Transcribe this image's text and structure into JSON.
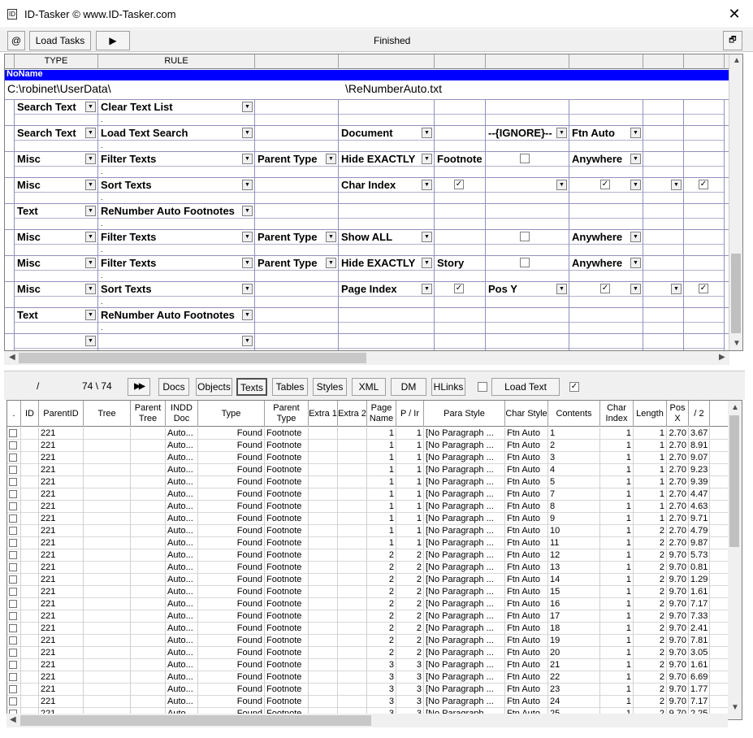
{
  "window": {
    "title": "ID-Tasker  © www.ID-Tasker.com",
    "close_glyph": "✕"
  },
  "toolbar": {
    "at_label": "@",
    "load_tasks": "Load Tasks",
    "play_glyph": "▶",
    "status": "Finished",
    "restore_glyph": "🗗"
  },
  "rules": {
    "header": {
      "type": "TYPE",
      "rule": "RULE"
    },
    "title_row": "NoName",
    "path_left": "C:\\robinet\\UserData\\",
    "path_right": "\\ReNumberAuto.txt",
    "rows": [
      {
        "type": "Search Text",
        "rule": "Clear Text List",
        "c3": "",
        "c4": "",
        "c5": "",
        "c6": "",
        "c7": ""
      },
      {
        "type": "Search Text",
        "rule": "Load Text Search",
        "c3": "",
        "c4": "Document",
        "c5": "",
        "c6": "--{IGNORE}--",
        "c7": "Ftn Auto"
      },
      {
        "type": "Misc",
        "rule": "Filter Texts",
        "c3": "Parent Type",
        "c4": "Hide EXACTLY",
        "c5": "Footnote",
        "c6": "",
        "c7": "Anywhere"
      },
      {
        "type": "Misc",
        "rule": "Sort Texts",
        "c3": "",
        "c4": "Char Index",
        "c5": "",
        "c6": "",
        "c7": ""
      },
      {
        "type": "Text",
        "rule": "ReNumber Auto Footnotes",
        "c3": "",
        "c4": "",
        "c5": "",
        "c6": "",
        "c7": ""
      },
      {
        "type": "Misc",
        "rule": "Filter Texts",
        "c3": "Parent Type",
        "c4": "Show ALL",
        "c5": "",
        "c6": "",
        "c7": "Anywhere"
      },
      {
        "type": "Misc",
        "rule": "Filter Texts",
        "c3": "Parent Type",
        "c4": "Hide EXACTLY",
        "c5": "Story",
        "c6": "",
        "c7": "Anywhere"
      },
      {
        "type": "Misc",
        "rule": "Sort Texts",
        "c3": "",
        "c4": "Page Index",
        "c5": "",
        "c6": "Pos Y",
        "c7": ""
      },
      {
        "type": "Text",
        "rule": "ReNumber Auto Footnotes",
        "c3": "",
        "c4": "",
        "c5": "",
        "c6": "",
        "c7": ""
      },
      {
        "type": "",
        "rule": "",
        "c3": "",
        "c4": "",
        "c5": "",
        "c6": "",
        "c7": ""
      }
    ]
  },
  "lower_toolbar": {
    "slash": "/",
    "count": "74 \\ 74",
    "ff_glyph": "▶▶",
    "docs": "Docs",
    "objects": "Objects",
    "texts": "Texts",
    "tables": "Tables",
    "styles": "Styles",
    "xml": "XML",
    "dm": "DM",
    "hlinks": "HLinks",
    "load_text": "Load Text",
    "check_mark": "✓"
  },
  "grid": {
    "headers": [
      ".",
      "ID",
      "ParentID",
      "Tree",
      "Parent Tree",
      "INDD Doc",
      "Type",
      "Parent Type",
      "Extra 1",
      "Extra 2",
      "Page Name",
      "P / Ir",
      "Para Style",
      "Char Style",
      "Contents",
      "Char Index",
      "Length",
      "Pos X",
      "/ 2"
    ],
    "rows": [
      [
        "221",
        "Auto...",
        "Found",
        "Footnote",
        "1",
        "1",
        "[No Paragraph ...",
        "Ftn Auto",
        "1",
        "1",
        "1",
        "2.70",
        "3.67"
      ],
      [
        "221",
        "Auto...",
        "Found",
        "Footnote",
        "1",
        "1",
        "[No Paragraph ...",
        "Ftn Auto",
        "2",
        "1",
        "1",
        "2.70",
        "8.91"
      ],
      [
        "221",
        "Auto...",
        "Found",
        "Footnote",
        "1",
        "1",
        "[No Paragraph ...",
        "Ftn Auto",
        "3",
        "1",
        "1",
        "2.70",
        "9.07"
      ],
      [
        "221",
        "Auto...",
        "Found",
        "Footnote",
        "1",
        "1",
        "[No Paragraph ...",
        "Ftn Auto",
        "4",
        "1",
        "1",
        "2.70",
        "9.23"
      ],
      [
        "221",
        "Auto...",
        "Found",
        "Footnote",
        "1",
        "1",
        "[No Paragraph ...",
        "Ftn Auto",
        "5",
        "1",
        "1",
        "2.70",
        "9.39"
      ],
      [
        "221",
        "Auto...",
        "Found",
        "Footnote",
        "1",
        "1",
        "[No Paragraph ...",
        "Ftn Auto",
        "7",
        "1",
        "1",
        "2.70",
        "4.47"
      ],
      [
        "221",
        "Auto...",
        "Found",
        "Footnote",
        "1",
        "1",
        "[No Paragraph ...",
        "Ftn Auto",
        "8",
        "1",
        "1",
        "2.70",
        "4.63"
      ],
      [
        "221",
        "Auto...",
        "Found",
        "Footnote",
        "1",
        "1",
        "[No Paragraph ...",
        "Ftn Auto",
        "9",
        "1",
        "1",
        "2.70",
        "9.71"
      ],
      [
        "221",
        "Auto...",
        "Found",
        "Footnote",
        "1",
        "1",
        "[No Paragraph ...",
        "Ftn Auto",
        "10",
        "1",
        "2",
        "2.70",
        "4.79"
      ],
      [
        "221",
        "Auto...",
        "Found",
        "Footnote",
        "1",
        "1",
        "[No Paragraph ...",
        "Ftn Auto",
        "11",
        "1",
        "2",
        "2.70",
        "9.87"
      ],
      [
        "221",
        "Auto...",
        "Found",
        "Footnote",
        "2",
        "2",
        "[No Paragraph ...",
        "Ftn Auto",
        "12",
        "1",
        "2",
        "9.70",
        "5.73"
      ],
      [
        "221",
        "Auto...",
        "Found",
        "Footnote",
        "2",
        "2",
        "[No Paragraph ...",
        "Ftn Auto",
        "13",
        "1",
        "2",
        "9.70",
        "0.81"
      ],
      [
        "221",
        "Auto...",
        "Found",
        "Footnote",
        "2",
        "2",
        "[No Paragraph ...",
        "Ftn Auto",
        "14",
        "1",
        "2",
        "9.70",
        "1.29"
      ],
      [
        "221",
        "Auto...",
        "Found",
        "Footnote",
        "2",
        "2",
        "[No Paragraph ...",
        "Ftn Auto",
        "15",
        "1",
        "2",
        "9.70",
        "1.61"
      ],
      [
        "221",
        "Auto...",
        "Found",
        "Footnote",
        "2",
        "2",
        "[No Paragraph ...",
        "Ftn Auto",
        "16",
        "1",
        "2",
        "9.70",
        "7.17"
      ],
      [
        "221",
        "Auto...",
        "Found",
        "Footnote",
        "2",
        "2",
        "[No Paragraph ...",
        "Ftn Auto",
        "17",
        "1",
        "2",
        "9.70",
        "7.33"
      ],
      [
        "221",
        "Auto...",
        "Found",
        "Footnote",
        "2",
        "2",
        "[No Paragraph ...",
        "Ftn Auto",
        "18",
        "1",
        "2",
        "9.70",
        "2.41"
      ],
      [
        "221",
        "Auto...",
        "Found",
        "Footnote",
        "2",
        "2",
        "[No Paragraph ...",
        "Ftn Auto",
        "19",
        "1",
        "2",
        "9.70",
        "7.81"
      ],
      [
        "221",
        "Auto...",
        "Found",
        "Footnote",
        "2",
        "2",
        "[No Paragraph ...",
        "Ftn Auto",
        "20",
        "1",
        "2",
        "9.70",
        "3.05"
      ],
      [
        "221",
        "Auto...",
        "Found",
        "Footnote",
        "3",
        "3",
        "[No Paragraph ...",
        "Ftn Auto",
        "21",
        "1",
        "2",
        "9.70",
        "1.61"
      ],
      [
        "221",
        "Auto...",
        "Found",
        "Footnote",
        "3",
        "3",
        "[No Paragraph ...",
        "Ftn Auto",
        "22",
        "1",
        "2",
        "9.70",
        "6.69"
      ],
      [
        "221",
        "Auto...",
        "Found",
        "Footnote",
        "3",
        "3",
        "[No Paragraph ...",
        "Ftn Auto",
        "23",
        "1",
        "2",
        "9.70",
        "1.77"
      ],
      [
        "221",
        "Auto...",
        "Found",
        "Footnote",
        "3",
        "3",
        "[No Paragraph ...",
        "Ftn Auto",
        "24",
        "1",
        "2",
        "9.70",
        "7.17"
      ],
      [
        "221",
        "Auto...",
        "Found",
        "Footnote",
        "3",
        "3",
        "[No Paragraph ...",
        "Ftn Auto",
        "25",
        "1",
        "2",
        "9.70",
        "2.25"
      ]
    ]
  }
}
